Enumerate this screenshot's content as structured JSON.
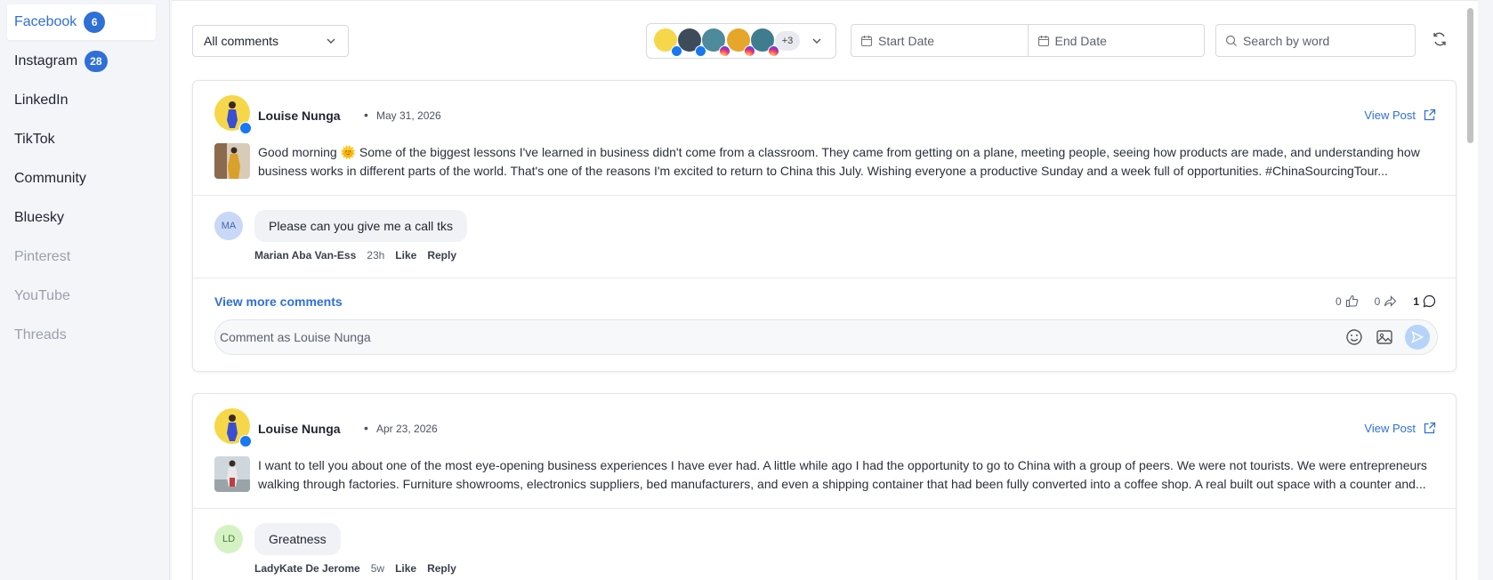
{
  "sidebar": {
    "items": [
      {
        "label": "Facebook",
        "badge": "6"
      },
      {
        "label": "Instagram",
        "badge": "28"
      },
      {
        "label": "LinkedIn"
      },
      {
        "label": "TikTok"
      },
      {
        "label": "Community"
      },
      {
        "label": "Bluesky"
      },
      {
        "label": "Pinterest"
      },
      {
        "label": "YouTube"
      },
      {
        "label": "Threads"
      }
    ]
  },
  "toolbar": {
    "filter_value": "All comments",
    "accounts_more": "+3",
    "start_date_placeholder": "Start Date",
    "end_date_placeholder": "End Date",
    "search_placeholder": "Search by word"
  },
  "colors": {
    "accent": "#2f6fd8",
    "facebook": "#1877f2",
    "instagram": "#d6249f"
  },
  "posts": [
    {
      "author": "Louise Nunga",
      "date": "May 31, 2026",
      "view_post": "View Post",
      "text": "Good morning 🌞 Some of the biggest lessons I've learned in business didn't come from a classroom. They came from getting on a plane, meeting people, seeing how products are made, and understanding how business works in different parts of the world. That's one of the reasons I'm excited to return to China this July. Wishing everyone a productive Sunday and a week full of opportunities. #ChinaSourcingTour...",
      "comment": {
        "initials": "MA",
        "text": "Please can you give me a call tks",
        "name": "Marian Aba Van-Ess",
        "time": "23h",
        "like": "Like",
        "reply": "Reply"
      },
      "view_more": "View more comments",
      "likes": "0",
      "shares": "0",
      "comments": "1",
      "comment_placeholder": "Comment as Louise Nunga"
    },
    {
      "author": "Louise Nunga",
      "date": "Apr 23, 2026",
      "view_post": "View Post",
      "text": "I want to tell you about one of the most eye-opening business experiences I have ever had. A little while ago I had the opportunity to go to China with a group of peers. We were not tourists. We were entrepreneurs walking through factories. Furniture showrooms, electronics suppliers, bed manufacturers, and even a shipping container that had been fully converted into a coffee shop. A real built out space with a counter and...",
      "comment": {
        "initials": "LD",
        "text": "Greatness",
        "name": "LadyKate De Jerome",
        "time": "5w",
        "like": "Like",
        "reply": "Reply"
      }
    }
  ]
}
